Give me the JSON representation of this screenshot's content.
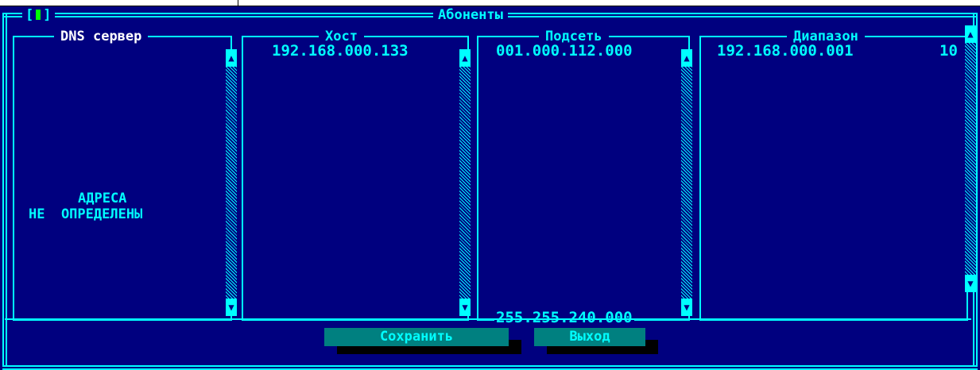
{
  "window": {
    "title": "Абоненты",
    "close_left": "[",
    "close_right": "]"
  },
  "panels": {
    "dns": {
      "header": "DNS сервер",
      "header_prefix": "DNS",
      "header_word": "сервер",
      "empty_line1": "АДРЕСА",
      "empty_line2": "НЕ  ОПРЕДЕЛЕНЫ"
    },
    "host": {
      "header": "Хост",
      "value": "192.168.000.133"
    },
    "subnet": {
      "header": "Подсеть",
      "value": "001.000.112.000",
      "bottom_value": "255.255.240.000"
    },
    "range": {
      "header": "Диапазон",
      "value": "192.168.000.001",
      "value_cut": "10"
    }
  },
  "buttons": {
    "save": "Сохранить",
    "exit": "Выход"
  },
  "colors": {
    "background": "#00007f",
    "frame": "#00ffff",
    "button": "#008080",
    "close_marker": "#00ff00"
  }
}
